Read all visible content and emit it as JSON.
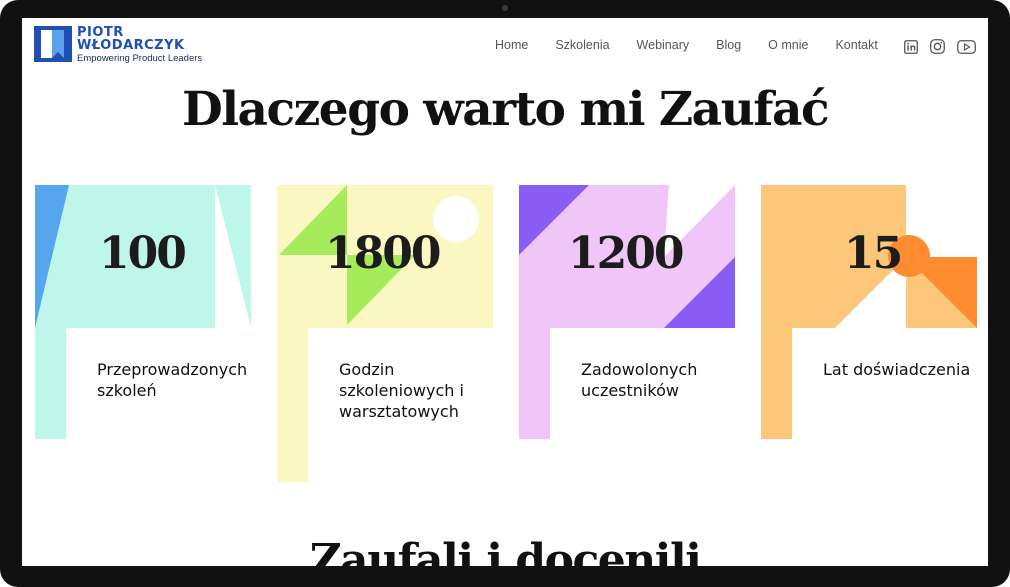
{
  "brand": {
    "name_line1": "PIOTR",
    "name_line2": "WŁODARCZYK",
    "tagline": "Empowering Product Leaders",
    "color": "#1d4fb5"
  },
  "nav": {
    "items": [
      "Home",
      "Szkolenia",
      "Webinary",
      "Blog",
      "O mnie",
      "Kontakt"
    ]
  },
  "social": {
    "icons": [
      "linkedin-icon",
      "instagram-icon",
      "youtube-icon"
    ]
  },
  "section": {
    "title": "Dlaczego warto mi Zaufać",
    "next_title": "Zaufali i docenili"
  },
  "stats": [
    {
      "value": "100",
      "label": "Przeprowadzonych szkoleń",
      "color": "#bff6ea"
    },
    {
      "value": "1800",
      "label": "Godzin szkoleniowych i warsztatowych",
      "color": "#fbf7c2"
    },
    {
      "value": "1200",
      "label": "Zadowolonych uczestników",
      "color": "#efc6f7"
    },
    {
      "value": "15",
      "label": "Lat doświadczenia",
      "color": "#fdc77a"
    }
  ]
}
